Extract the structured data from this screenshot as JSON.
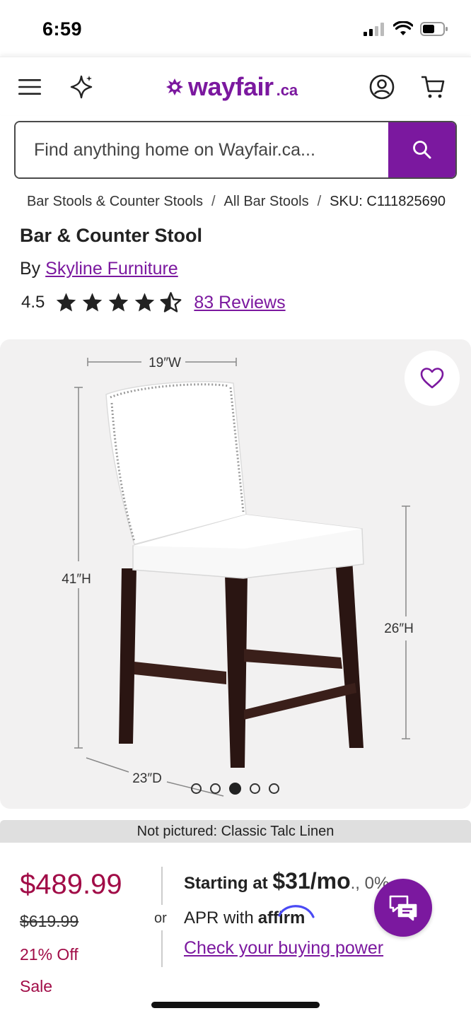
{
  "status_bar": {
    "time": "6:59"
  },
  "header": {
    "logo_text": "wayfair",
    "logo_suffix": ".ca",
    "menu_icon": "hamburger-menu-icon",
    "ai_icon": "sparkle-icon",
    "account_icon": "account-icon",
    "cart_icon": "cart-icon"
  },
  "search": {
    "placeholder": "Find anything home on Wayfair.ca...",
    "value": "",
    "button_icon": "search-icon"
  },
  "breadcrumb": {
    "items": [
      "Bar Stools & Counter Stools",
      "All Bar Stools"
    ],
    "sku": "SKU: C111825690",
    "separator": "/"
  },
  "product": {
    "title": "Bar & Counter Stool",
    "by_label": "By",
    "brand": "Skyline Furniture",
    "rating": "4.5",
    "rating_value": 4.5,
    "rating_max": 5,
    "reviews_label": "83 Reviews"
  },
  "gallery": {
    "dimensions": {
      "width": "19″W",
      "height": "41″H",
      "seat_height": "26″H",
      "depth": "23″D"
    },
    "dots_count": 5,
    "active_dot_index": 2,
    "favorite_icon": "heart-icon"
  },
  "note": {
    "text": "Not pictured: Classic Talc Linen"
  },
  "pricing": {
    "price": "$489.99",
    "was_price": "$619.99",
    "discount": "21% Off",
    "sale_label": "Sale",
    "or_label": "or",
    "starting_at": "Starting at",
    "monthly": "$31/mo",
    "monthly_suffix": "., 0%",
    "apr_with": "APR with",
    "affirm": "affirm",
    "check_power": "Check your buying power"
  },
  "chat": {
    "icon": "chat-icon"
  },
  "colors": {
    "brand_purple": "#7b189f",
    "sale_red": "#a10c47",
    "gallery_bg": "#f2f1f1"
  }
}
